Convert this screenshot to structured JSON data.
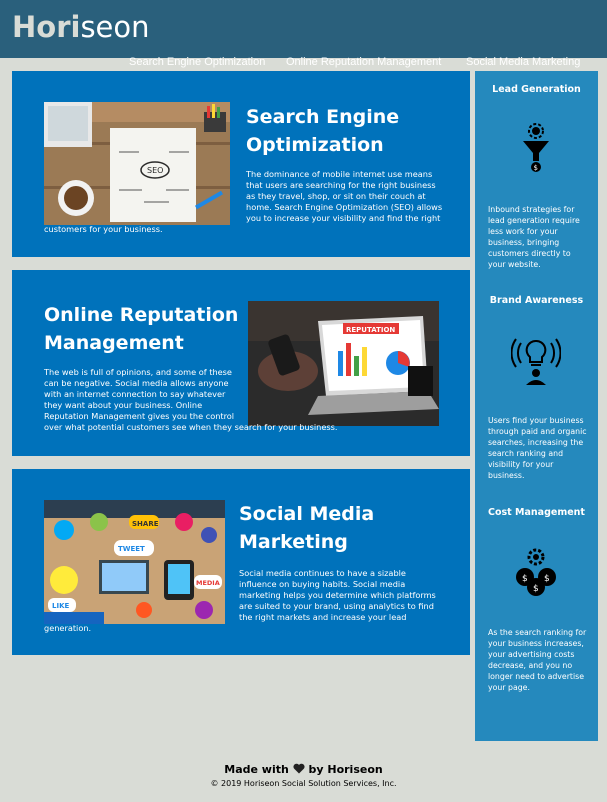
{
  "header": {
    "logo_main": "Hori",
    "logo_accent": "seon",
    "nav": [
      {
        "label": "Search Engine Optimization"
      },
      {
        "label": "Online Reputation Management"
      },
      {
        "label": "Social Media Marketing"
      }
    ]
  },
  "content": [
    {
      "title": "Search Engine Optimization",
      "text": "The dominance of mobile internet use means that users are searching for the right business as they travel, shop, or sit on their couch at home. Search Engine Optimization (SEO) allows you to increase your visibility and find the right customers for your business.",
      "image_label": "SEO"
    },
    {
      "title": "Online Reputation Management",
      "text": "The web is full of opinions, and some of these can be negative. Social media allows anyone with an internet connection to say whatever they want about your business. Online Reputation Management gives you the control over what potential customers see when they search for your business.",
      "image_label": "REPUTATION"
    },
    {
      "title": "Social Media Marketing",
      "text": "Social media continues to have a sizable influence on buying habits. Social media marketing helps you determine which platforms are suited to your brand, using analytics to find the right markets and increase your lead generation.",
      "image_labels": [
        "SHARE",
        "TWEET",
        "LIKE",
        "MEDIA"
      ]
    }
  ],
  "benefits": [
    {
      "title": "Lead Generation",
      "icon": "lead-generation-icon",
      "text": "Inbound strategies for lead generation require less work for your business, bringing customers directly to your website."
    },
    {
      "title": "Brand Awareness",
      "icon": "brand-awareness-icon",
      "text": "Users find your business through paid and organic searches, increasing the search ranking and visibility for your business."
    },
    {
      "title": "Cost Management",
      "icon": "cost-management-icon",
      "text": "As the search ranking for your business increases, your advertising costs decrease, and you no longer need to advertise your page."
    }
  ],
  "footer": {
    "made_prefix": "Made with",
    "made_suffix": "by Horiseon",
    "copyright": "© 2019 Horiseon Social Solution Services, Inc."
  }
}
